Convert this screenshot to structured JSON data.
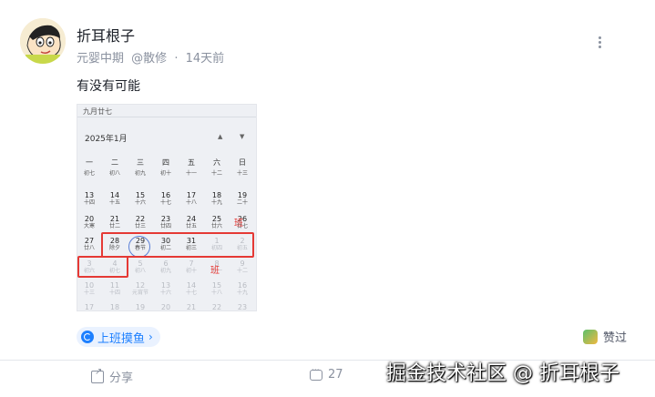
{
  "post": {
    "author": "折耳根子",
    "level": "元婴中期",
    "handle": "@散修",
    "separator": "·",
    "time": "14天前",
    "text": "有没有可能"
  },
  "calendar_image": {
    "top_label": "九月廿七",
    "month": "2025年1月",
    "up_arrow": "▲",
    "down_arrow": "▼",
    "weekdays": [
      "一",
      "二",
      "三",
      "四",
      "五",
      "六",
      "日"
    ],
    "rows": [
      [
        [
          "",
          "初七"
        ],
        [
          "",
          "初八"
        ],
        [
          "",
          "初九"
        ],
        [
          "",
          "初十"
        ],
        [
          "",
          "十一"
        ],
        [
          "",
          "十二"
        ],
        [
          "",
          "十三"
        ]
      ],
      [
        [
          "13",
          "十四"
        ],
        [
          "14",
          "十五"
        ],
        [
          "15",
          "十六"
        ],
        [
          "16",
          "十七"
        ],
        [
          "17",
          "十八"
        ],
        [
          "18",
          "十九"
        ],
        [
          "19",
          "二十"
        ]
      ],
      [
        [
          "20",
          "大寒"
        ],
        [
          "21",
          "廿二"
        ],
        [
          "22",
          "廿三"
        ],
        [
          "23",
          "廿四"
        ],
        [
          "24",
          "廿五"
        ],
        [
          "25",
          "廿六"
        ],
        [
          "26",
          "廿七"
        ]
      ],
      [
        [
          "27",
          "廿八"
        ],
        [
          "28",
          "除夕"
        ],
        [
          "29",
          "春节"
        ],
        [
          "30",
          "初二"
        ],
        [
          "31",
          "初三"
        ],
        [
          "1",
          "初四"
        ],
        [
          "2",
          "初五"
        ]
      ],
      [
        [
          "3",
          "初六"
        ],
        [
          "4",
          "初七"
        ],
        [
          "5",
          "初八"
        ],
        [
          "6",
          "初九"
        ],
        [
          "7",
          "初十"
        ],
        [
          "8",
          "十一"
        ],
        [
          "9",
          "十二"
        ]
      ],
      [
        [
          "10",
          "十三"
        ],
        [
          "11",
          "十四"
        ],
        [
          "12",
          "元宵节"
        ],
        [
          "13",
          "十六"
        ],
        [
          "14",
          "十七"
        ],
        [
          "15",
          "十八"
        ],
        [
          "16",
          "十九"
        ]
      ],
      [
        [
          "17",
          ""
        ],
        [
          "18",
          ""
        ],
        [
          "19",
          ""
        ],
        [
          "20",
          ""
        ],
        [
          "21",
          ""
        ],
        [
          "22",
          ""
        ],
        [
          "23",
          ""
        ]
      ]
    ],
    "mark_top": "班",
    "mark_bottom": "班"
  },
  "tag": {
    "label": "上班摸鱼",
    "chevron": "›"
  },
  "actions": {
    "admire": "赞过",
    "share": "分享",
    "comment_count": "27"
  },
  "watermark": "掘金技术社区 @ 折耳根子",
  "colors": {
    "accent": "#1e80ff",
    "highlight": "#e53935",
    "muted": "#8a919f"
  }
}
